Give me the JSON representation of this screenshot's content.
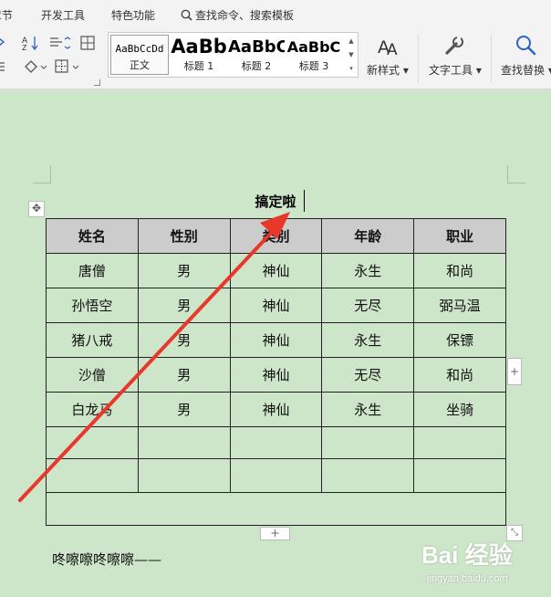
{
  "menu": {
    "items": [
      "章节",
      "开发工具",
      "特色功能"
    ],
    "search": "查找命令、搜索模板"
  },
  "ribbon": {
    "styles": [
      {
        "preview": "AaBbCcDd",
        "label": "正文"
      },
      {
        "preview": "AaBb",
        "label": "标题 1"
      },
      {
        "preview": "AaBbC",
        "label": "标题 2"
      },
      {
        "preview": "AaBbC",
        "label": "标题 3"
      }
    ],
    "new_style": "新样式",
    "text_tools": "文字工具",
    "find_replace": "查找替换"
  },
  "document": {
    "title": "搞定啦",
    "headers": [
      "姓名",
      "性别",
      "类别",
      "年龄",
      "职业"
    ],
    "rows": [
      [
        "唐僧",
        "男",
        "神仙",
        "永生",
        "和尚"
      ],
      [
        "孙悟空",
        "男",
        "神仙",
        "无尽",
        "弼马温"
      ],
      [
        "猪八戒",
        "男",
        "神仙",
        "永生",
        "保镖"
      ],
      [
        "沙僧",
        "男",
        "神仙",
        "无尽",
        "和尚"
      ],
      [
        "白龙马",
        "男",
        "神仙",
        "永生",
        "坐骑"
      ]
    ],
    "bottom_text": "咚嚓嚓咚嚓嚓——"
  },
  "watermark": {
    "logo": "Bai 经验",
    "url": "jingyan.baidu.com"
  },
  "colors": {
    "page_bg": "#cde6c9",
    "header_fill": "#cccccc",
    "arrow": "#e8372b"
  }
}
